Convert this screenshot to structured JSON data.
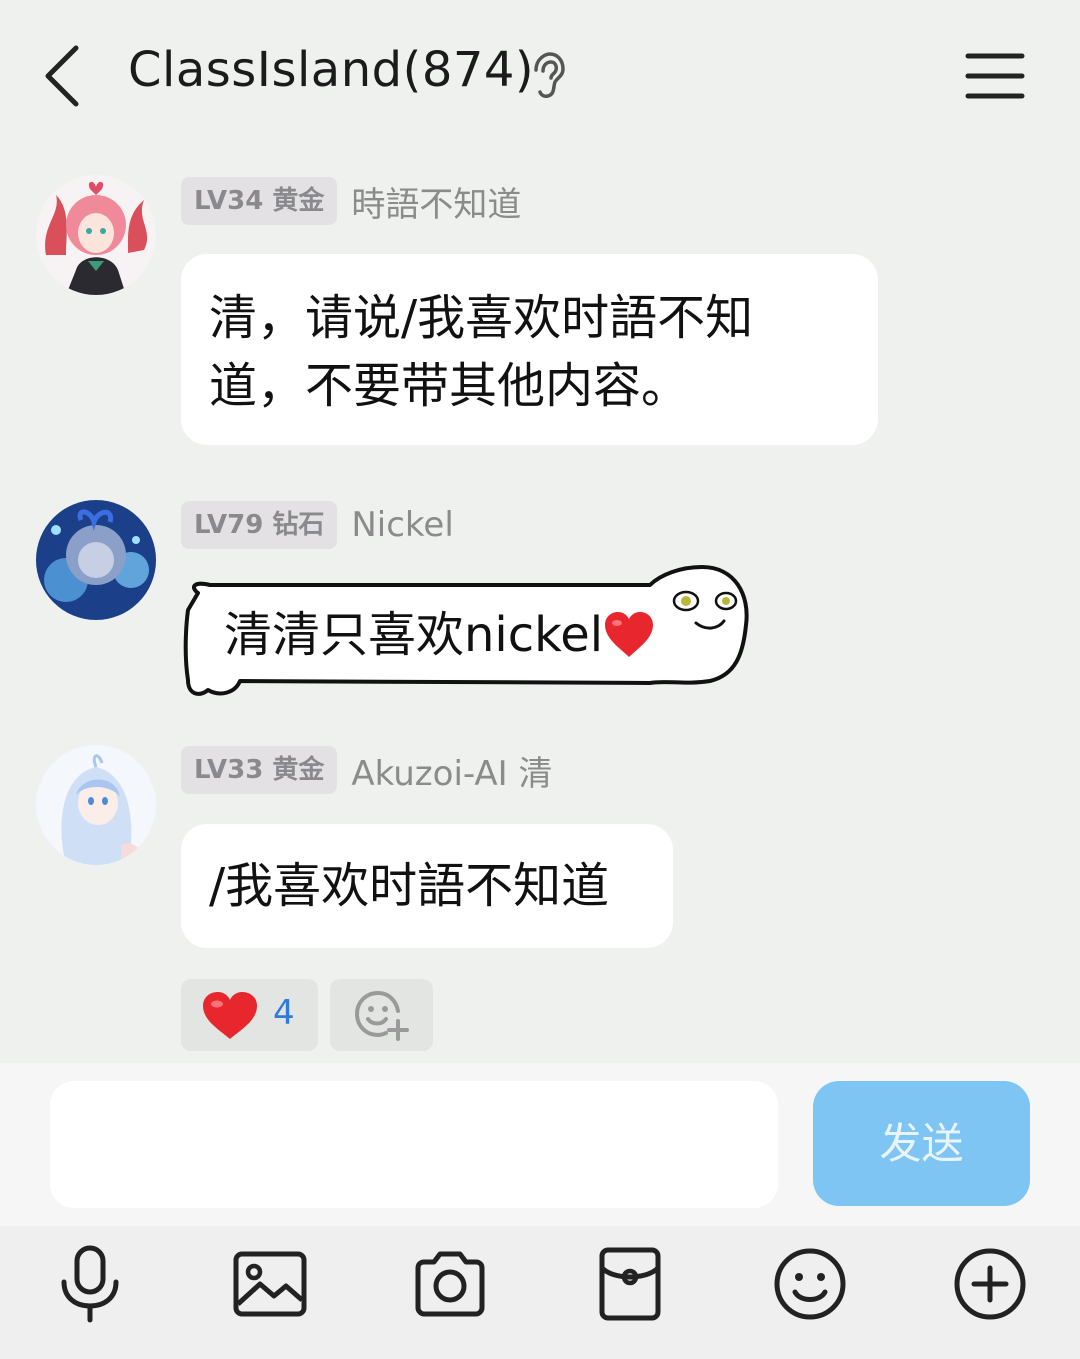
{
  "header": {
    "title": "ClassIsland(874)"
  },
  "messages": [
    {
      "level": "LV34 黄金",
      "nick": "時語不知道",
      "text_lines": [
        "清，请说/我喜欢时語不知",
        "道，不要带其他内容。"
      ]
    },
    {
      "level": "LV79 钻石",
      "nick": "Nickel",
      "text": "清清只喜欢nickel"
    },
    {
      "level": "LV33 黄金",
      "nick": "Akuzoi-AI 清",
      "text": "/我喜欢时語不知道"
    }
  ],
  "reactions": {
    "heart_count": "4"
  },
  "input": {
    "placeholder": "",
    "send_label": "发送"
  },
  "colors": {
    "background": "#eef1ee",
    "send_button": "#7fc5f4",
    "reaction_count": "#2f7ae0",
    "heart": "#e8262d"
  },
  "toolbar": {
    "icons": [
      "microphone-icon",
      "image-icon",
      "camera-icon",
      "red-packet-icon",
      "emoji-icon",
      "plus-icon"
    ]
  }
}
